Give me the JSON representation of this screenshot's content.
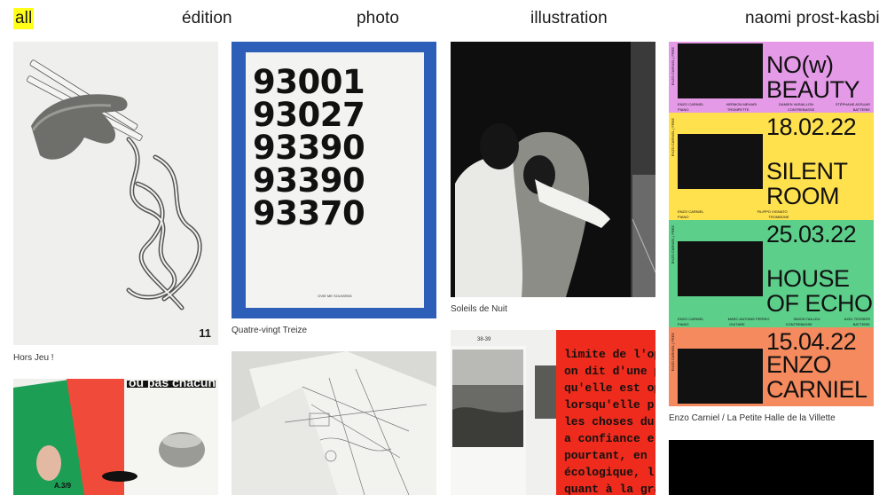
{
  "nav": {
    "all": "all",
    "edition": "édition",
    "photo": "photo",
    "illustration": "illustration",
    "author": "naomi prost-kasbi"
  },
  "accent_color": "#ffff1a",
  "tiles": {
    "hors_jeu": {
      "caption": "Hors Jeu !",
      "page_number": "11"
    },
    "quatre_vingt_treize": {
      "caption": "Quatre-vingt Treize",
      "numbers": [
        "93001",
        "93027",
        "93390",
        "93390",
        "93370"
      ],
      "footer": "OVIE ME SOUVIENS"
    },
    "soleils_de_nuit": {
      "caption": "Soleils de Nuit"
    },
    "enzo_carniel": {
      "caption": "Enzo Carniel / La Petite Halle de la Villette",
      "posters": [
        {
          "lines": [
            "NO(w)",
            "BEAUTY"
          ],
          "color": "#e59ae8",
          "names": [
            "ENZO CARNIEL",
            "HERMON MEHARI",
            "DAMIEN VARAILLON",
            "STÉPHANE ADSUAR"
          ],
          "roles": [
            "PIANO",
            "TROMPETTE",
            "CONTREBASSE",
            "BATTERIE"
          ]
        },
        {
          "lines": [
            "18.02.22",
            "SILENT",
            "ROOM"
          ],
          "color": "#ffe04d",
          "names": [
            "ENZO CARNIEL",
            "FILIPPO VIGNATO"
          ],
          "roles": [
            "PIANO",
            "TROMBONE"
          ]
        },
        {
          "lines": [
            "25.03.22",
            "HOUSE",
            "OF ECHO"
          ],
          "color": "#5ccf8a",
          "names": [
            "ENZO CARNIEL",
            "MARC ANTOINE PERRIO",
            "SIMON TAILLEU",
            "AXEL TEISSIER"
          ],
          "roles": [
            "PIANO",
            "GUITARE",
            "CONTREBASSE",
            "BATTERIE"
          ]
        },
        {
          "lines": [
            "15.04.22",
            "ENZO",
            "CARNIEL"
          ],
          "color": "#f58a5e",
          "names": [],
          "roles": []
        }
      ],
      "side_text": "ENZO CARNIEL | FREE"
    },
    "ou_pas": {
      "title": "ou pas chacun",
      "page": "A.3/9"
    },
    "map_book": {},
    "limite": {
      "page": "38-39",
      "lines": [
        "limite de l'opt",
        "on dit d'une p",
        "qu'elle est opt",
        "lorsqu'elle pre",
        "les choses du",
        "a confiance e",
        "pourtant, en",
        "écologique, l'",
        "quant à la gra"
      ]
    }
  }
}
